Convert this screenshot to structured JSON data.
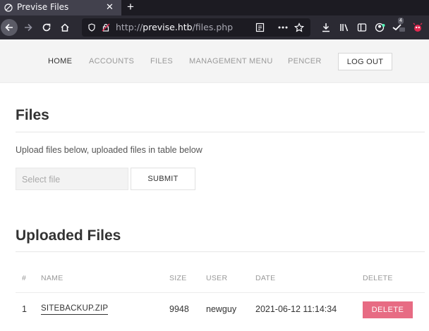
{
  "browser": {
    "tab_title": "Previse Files",
    "close_glyph": "✕",
    "newtab_glyph": "+",
    "url_scheme": "http://",
    "url_host": "previse.htb",
    "url_path": "/files.php",
    "extension_badge": "4"
  },
  "site_nav": {
    "items": [
      {
        "label": "HOME",
        "active": true
      },
      {
        "label": "ACCOUNTS",
        "active": false
      },
      {
        "label": "FILES",
        "active": false
      },
      {
        "label": "MANAGEMENT MENU",
        "active": false
      },
      {
        "label": "PENCER",
        "active": false
      }
    ],
    "logout_label": "LOG OUT"
  },
  "upload": {
    "heading": "Files",
    "description": "Upload files below, uploaded files in table below",
    "file_placeholder": "Select file",
    "submit_label": "SUBMIT"
  },
  "uploaded": {
    "heading": "Uploaded Files",
    "columns": [
      "#",
      "NAME",
      "SIZE",
      "USER",
      "DATE",
      "DELETE"
    ],
    "rows": [
      {
        "num": "1",
        "name": "SITEBACKUP.ZIP",
        "size": "9948",
        "user": "newguy",
        "date": "2021-06-12 11:14:34",
        "action": "DELETE"
      }
    ]
  },
  "colors": {
    "delete_button": "#e76b83",
    "chrome_dark": "#1c1b22"
  }
}
